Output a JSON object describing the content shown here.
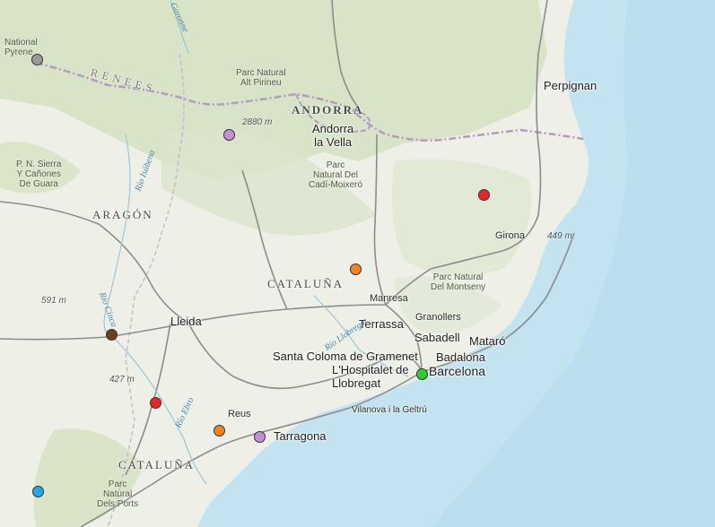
{
  "map": {
    "labels": {
      "perpignan": "Perpignan",
      "andorra": "ANDORRA",
      "andorra_la_vella": "Andorra\nla Vella",
      "aragon": "ARAGÓN",
      "cataluna_1": "CATALUÑA",
      "cataluna_2": "CATALUÑA",
      "girona": "Girona",
      "manresa": "Manresa",
      "terrassa": "Terrassa",
      "granollers": "Granollers",
      "sabadell": "Sabadell",
      "mataro": "Mataró",
      "badalona": "Badalona",
      "santa_coloma": "Santa Coloma de Gramenet",
      "hospitalet": "L'Hospitalet de\nLlobregat",
      "barcelona": "Barcelona",
      "lleida": "Lleida",
      "reus": "Reus",
      "tarragona": "Tarragona",
      "vilanova": "Vilanova i la Geltrú",
      "national_pyrenees": "National\nPyrene",
      "parc_alt_pirineu": "Parc Natural\nAlt Pirineu",
      "parc_cadi": "Parc\nNatural Del\nCadí-Moixeró",
      "parc_montseny": "Parc Natural\nDel Montseny",
      "pn_sierra_guara": "P. N. Sierra\nY Cañones\nDe Guara",
      "parc_ports": "Parc\nNatural\nDels Ports",
      "pyrenees_ridge": "RENEES",
      "elev_2880": "2880 m",
      "elev_449": "449 m",
      "elev_591": "591 m",
      "elev_427": "427 m",
      "rio_isabena": "Río Isábena",
      "rio_cinca": "Río Cinca",
      "rio_llobregat": "Río Llobregat",
      "rio_ebro": "Río Ebro",
      "rio_garonne": "Garonne"
    },
    "markers": [
      {
        "name": "marker-gray",
        "color": "#9a9a9a"
      },
      {
        "name": "marker-purple-pyrenees",
        "color": "#c58fd6"
      },
      {
        "name": "marker-red-girona",
        "color": "#e8242b"
      },
      {
        "name": "marker-orange-central",
        "color": "#f5821f"
      },
      {
        "name": "marker-brown",
        "color": "#6b3e1f"
      },
      {
        "name": "marker-green-barcelona",
        "color": "#2ecc2e"
      },
      {
        "name": "marker-red-ebro",
        "color": "#e8242b"
      },
      {
        "name": "marker-orange-reus",
        "color": "#f5821f"
      },
      {
        "name": "marker-purple-tarragona",
        "color": "#c58fd6"
      },
      {
        "name": "marker-blue",
        "color": "#27a8e6"
      }
    ],
    "colors": {
      "sea": "#c3e3f1",
      "land": "#eef0e8",
      "mountain": "#cfdcbc",
      "road": "#8c8c8c",
      "border": "#b59ac2"
    }
  }
}
